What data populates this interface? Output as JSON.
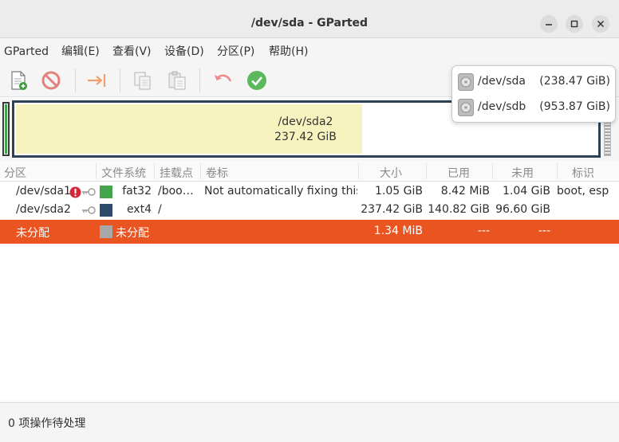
{
  "window": {
    "title": "/dev/sda - GParted"
  },
  "menu": [
    "GParted",
    "编辑(E)",
    "查看(V)",
    "设备(D)",
    "分区(P)",
    "帮助(H)"
  ],
  "toolbar": {
    "icons": [
      "new-partition-icon",
      "delete-icon",
      "resize-move-icon",
      "copy-icon",
      "paste-icon",
      "undo-icon",
      "apply-icon"
    ]
  },
  "devices": [
    {
      "name": "/dev/sda",
      "size": "(238.47 GiB)"
    },
    {
      "name": "/dev/sdb",
      "size": "(953.87 GiB)"
    }
  ],
  "diskmap": {
    "partition_name": "/dev/sda2",
    "partition_size": "237.42 GiB"
  },
  "columns": [
    "分区",
    "文件系统",
    "挂载点",
    "卷标",
    "大小",
    "已用",
    "未用",
    "标识"
  ],
  "partitions": [
    {
      "partition": "/dev/sda1",
      "filesystem": "fat32",
      "fs_color": "#42a54b",
      "mount": "/boo…",
      "label": "Not automatically fixing this.",
      "size": "1.05 GiB",
      "used": "8.42 MiB",
      "unused": "1.04 GiB",
      "flags": "boot, esp",
      "warning": true,
      "mounted": true
    },
    {
      "partition": "/dev/sda2",
      "filesystem": "ext4",
      "fs_color": "#2e4a6b",
      "mount": "/",
      "label": "",
      "size": "237.42 GiB",
      "used": "140.82 GiB",
      "unused": "96.60 GiB",
      "flags": "",
      "warning": false,
      "mounted": true
    },
    {
      "partition": "未分配",
      "filesystem": "未分配",
      "fs_color": "#a8a8a8",
      "mount": "",
      "label": "",
      "size": "1.34 MiB",
      "used": "---",
      "unused": "---",
      "flags": "",
      "warning": false,
      "mounted": false,
      "selected": true
    }
  ],
  "status": "0 项操作待处理",
  "colors": {
    "accent": "#e95420",
    "ext4": "#2e4a6b",
    "fat32": "#42a54b",
    "unallocated": "#a8a8a8"
  }
}
